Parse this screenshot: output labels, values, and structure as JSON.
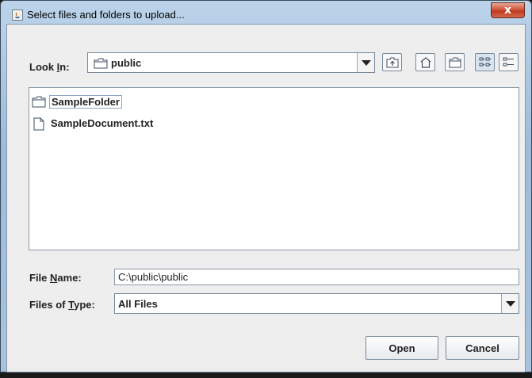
{
  "window": {
    "title": "Select files and folders to upload...",
    "close_glyph": "x"
  },
  "lookin": {
    "label_pre": "Look ",
    "label_mnemonic": "I",
    "label_post": "n:",
    "value": "public"
  },
  "toolbar": {
    "icons": [
      "up-one-level-icon",
      "home-icon",
      "new-folder-icon",
      "list-view-icon",
      "details-view-icon"
    ]
  },
  "files": [
    {
      "name": "SampleFolder",
      "type": "folder",
      "selected": true
    },
    {
      "name": "SampleDocument.txt",
      "type": "file",
      "selected": false
    }
  ],
  "filename": {
    "label_pre": "File ",
    "label_mnemonic": "N",
    "label_post": "ame:",
    "value": "C:\\public\\public"
  },
  "filetype": {
    "label_pre": "Files of ",
    "label_mnemonic": "T",
    "label_post": "ype:",
    "value": "All Files"
  },
  "buttons": {
    "open": "Open",
    "cancel": "Cancel"
  },
  "colors": {
    "titlebar": "#a9c3de",
    "client_bg": "#eeeeee",
    "close": "#c0391e"
  }
}
